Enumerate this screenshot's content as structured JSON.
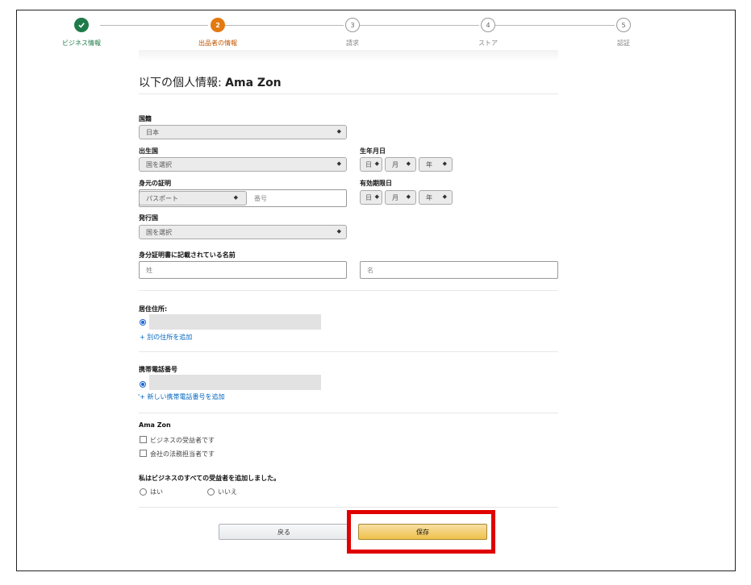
{
  "stepper": {
    "steps": [
      {
        "label": "ビジネス情報",
        "number": "✓",
        "state": "done"
      },
      {
        "label": "出品者の情報",
        "number": "2",
        "state": "current"
      },
      {
        "label": "請求",
        "number": "3",
        "state": "todo"
      },
      {
        "label": "ストア",
        "number": "4",
        "state": "todo"
      },
      {
        "label": "認証",
        "number": "5",
        "state": "todo"
      }
    ]
  },
  "header": {
    "title_prefix": "以下の個人情報: ",
    "title_name": "Ama Zon"
  },
  "form": {
    "nationality": {
      "label": "国籍",
      "value": "日本"
    },
    "birth_country": {
      "label": "出生国",
      "value": "国を選択"
    },
    "birth_date": {
      "label": "生年月日",
      "day": "日",
      "month": "月",
      "year": "年"
    },
    "id_proof": {
      "label": "身元の証明",
      "type_value": "パスポート",
      "number_placeholder": "番号"
    },
    "expiry_date": {
      "label": "有効期限日",
      "day": "日",
      "month": "月",
      "year": "年"
    },
    "issuing_country": {
      "label": "発行国",
      "value": "国を選択"
    },
    "id_name": {
      "label": "身分証明書に記載されている名前",
      "last_placeholder": "姓",
      "first_placeholder": "名"
    },
    "residence": {
      "label": "居住住所:",
      "add_link": "+ 別の住所を追加"
    },
    "mobile": {
      "label": "携帯電話番号",
      "add_link": "'+ 新しい携帯電話番号を追加"
    },
    "beneficiary": {
      "name": "Ama Zon",
      "options": [
        "ビジネスの受益者です",
        "会社の法務担当者です"
      ]
    },
    "all_added": {
      "label": "私はビジネスのすべての受益者を追加しました。",
      "yes": "はい",
      "no": "いいえ"
    }
  },
  "actions": {
    "back_label": "戻る",
    "save_label": "保存"
  },
  "colors": {
    "accent": "#e47911",
    "done": "#1f7a4a",
    "link": "#0066c0",
    "highlight": "#e00000",
    "save": "#f0c14b"
  }
}
